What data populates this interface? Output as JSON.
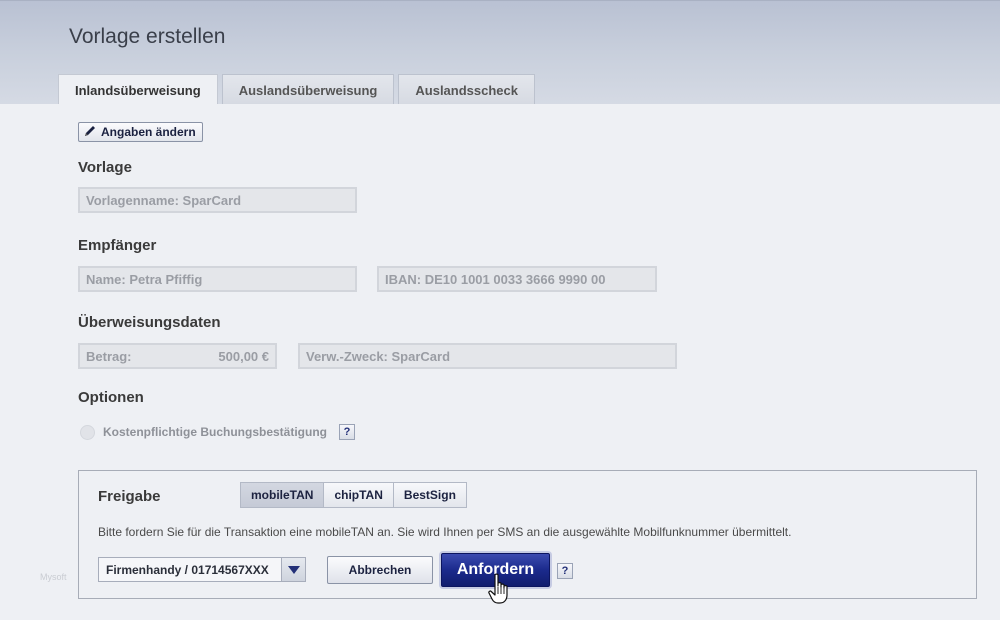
{
  "page": {
    "title": "Vorlage erstellen"
  },
  "tabs": [
    {
      "label": "Inlandsüberweisung",
      "active": true
    },
    {
      "label": "Auslandsüberweisung",
      "active": false
    },
    {
      "label": "Auslandsscheck",
      "active": false
    }
  ],
  "edit_button": {
    "label": "Angaben ändern",
    "icon": "pencil-icon"
  },
  "vorlage": {
    "heading": "Vorlage",
    "name_field": "Vorlagenname: SparCard"
  },
  "empfaenger": {
    "heading": "Empfänger",
    "name_field": "Name: Petra Pfiffig",
    "iban_field": "IBAN:  DE10 1001 0033 3666 9990 00"
  },
  "ueberweisung": {
    "heading": "Überweisungsdaten",
    "betrag_label": "Betrag:",
    "betrag_value": "500,00 €",
    "zweck_field": "Verw.-Zweck: SparCard"
  },
  "optionen": {
    "heading": "Optionen",
    "option_label": "Kostenpflichtige Buchungsbestätigung",
    "help": "?"
  },
  "freigabe": {
    "heading": "Freigabe",
    "methods": [
      {
        "label": "mobileTAN",
        "active": true
      },
      {
        "label": "chipTAN",
        "active": false
      },
      {
        "label": "BestSign",
        "active": false
      }
    ],
    "info": "Bitte fordern Sie für die Transaktion eine mobileTAN an. Sie wird Ihnen per SMS an die ausgewählte Mobilfunknummer übermittelt.",
    "phone_selected": "Firmenhandy / 01714567XXX",
    "cancel_label": "Abbrechen",
    "submit_label": "Anfordern",
    "help": "?"
  },
  "watermark": "Mysoft",
  "colors": {
    "primary_button": "#1b2a8c",
    "header": "#c8cfdc",
    "background": "#eef0f4"
  }
}
